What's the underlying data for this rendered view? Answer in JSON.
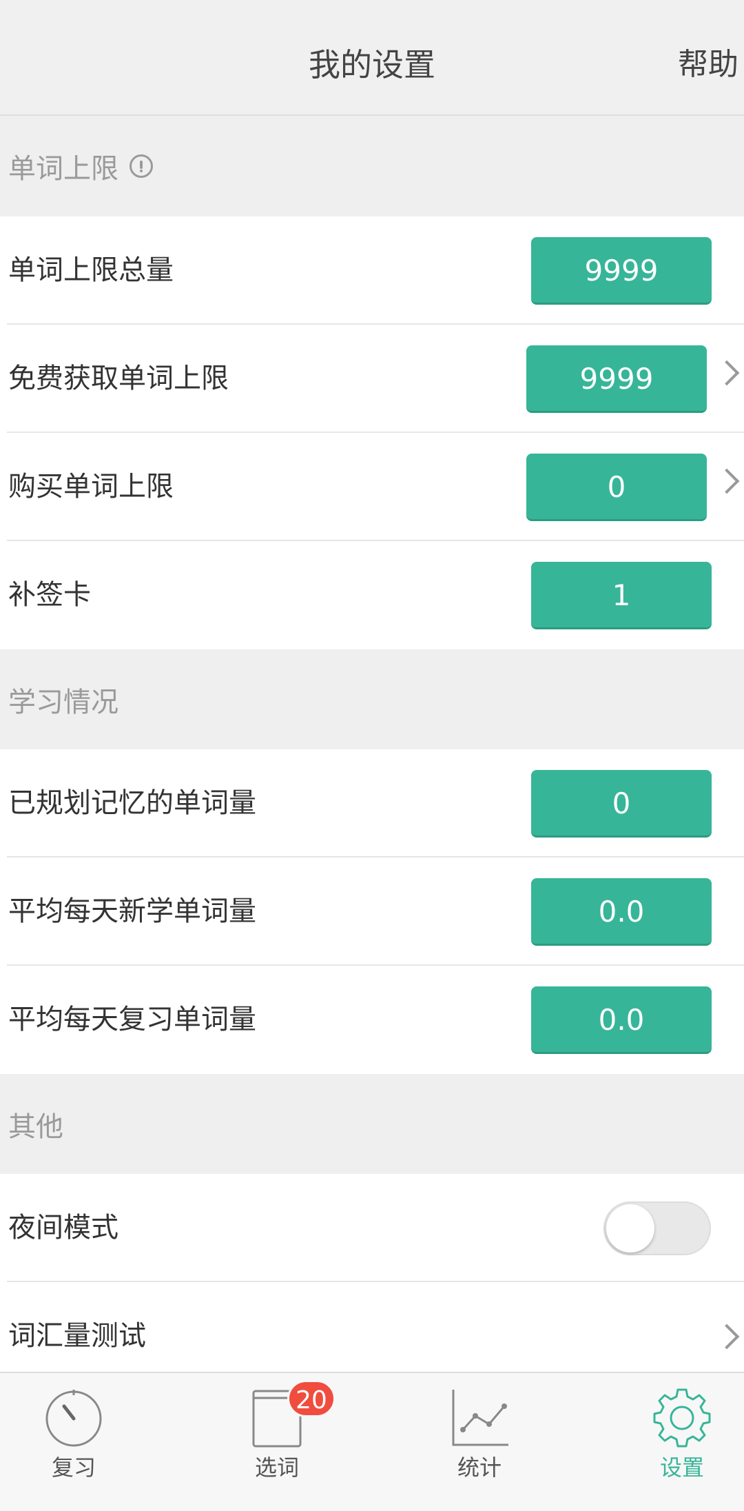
{
  "header": {
    "title": "我的设置",
    "help": "帮助"
  },
  "sections": {
    "limits": {
      "title": "单词上限",
      "rows": [
        {
          "label": "单词上限总量",
          "value": "9999"
        },
        {
          "label": "免费获取单词上限",
          "value": "9999"
        },
        {
          "label": "购买单词上限",
          "value": "0"
        },
        {
          "label": "补签卡",
          "value": "1"
        }
      ]
    },
    "study": {
      "title": "学习情况",
      "rows": [
        {
          "label": "已规划记忆的单词量",
          "value": "0"
        },
        {
          "label": "平均每天新学单词量",
          "value": "0.0"
        },
        {
          "label": "平均每天复习单词量",
          "value": "0.0"
        }
      ]
    },
    "other": {
      "title": "其他",
      "rows": [
        {
          "label": "夜间模式",
          "toggle": false
        },
        {
          "label": "词汇量测试"
        }
      ]
    }
  },
  "tabs": [
    {
      "label": "复习",
      "icon": "timer-icon"
    },
    {
      "label": "选词",
      "icon": "book-icon",
      "badge": "20"
    },
    {
      "label": "统计",
      "icon": "chart-icon"
    },
    {
      "label": "设置",
      "icon": "gear-icon",
      "active": true
    }
  ],
  "colors": {
    "accent": "#37b598",
    "badge": "#f04d3f",
    "active_tab": "#37b598"
  }
}
